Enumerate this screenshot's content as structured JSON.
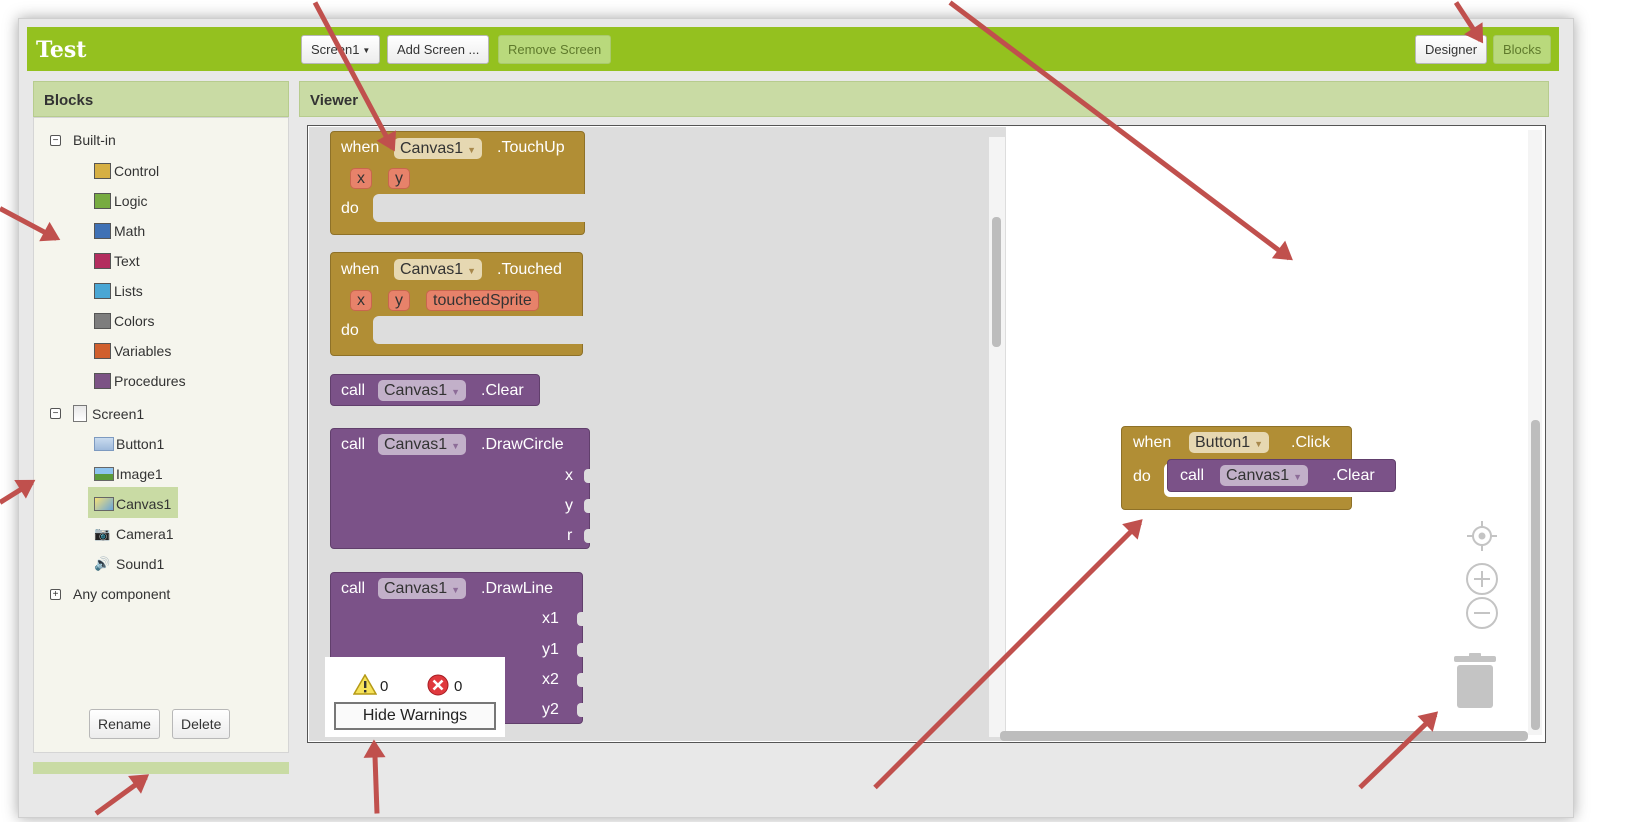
{
  "app": {
    "title": "Test"
  },
  "toolbar": {
    "screen_select": "Screen1",
    "add_screen": "Add Screen ...",
    "remove_screen": "Remove Screen",
    "designer": "Designer",
    "blocks": "Blocks"
  },
  "blocks_panel": {
    "title": "Blocks",
    "builtin_label": "Built-in",
    "builtin_items": [
      {
        "label": "Control",
        "color": "#d6af43"
      },
      {
        "label": "Logic",
        "color": "#77ab41"
      },
      {
        "label": "Math",
        "color": "#3f71b5"
      },
      {
        "label": "Text",
        "color": "#b32d5e"
      },
      {
        "label": "Lists",
        "color": "#49a6d4"
      },
      {
        "label": "Colors",
        "color": "#7d7d7d"
      },
      {
        "label": "Variables",
        "color": "#d05f2d"
      },
      {
        "label": "Procedures",
        "color": "#7c5385"
      }
    ],
    "screen_label": "Screen1",
    "components": [
      "Button1",
      "Image1",
      "Canvas1",
      "Camera1",
      "Sound1"
    ],
    "any_component": "Any component",
    "rename": "Rename",
    "delete": "Delete"
  },
  "viewer": {
    "title": "Viewer"
  },
  "flyout": {
    "touchup": {
      "when": "when",
      "component": "Canvas1",
      "event": ".TouchUp",
      "params": [
        "x",
        "y"
      ],
      "do": "do"
    },
    "touched": {
      "when": "when",
      "component": "Canvas1",
      "event": ".Touched",
      "params": [
        "x",
        "y",
        "touchedSprite"
      ],
      "do": "do"
    },
    "clear": {
      "call": "call",
      "component": "Canvas1",
      "method": ".Clear"
    },
    "drawcircle": {
      "call": "call",
      "component": "Canvas1",
      "method": ".DrawCircle",
      "args": [
        "x",
        "y",
        "r"
      ]
    },
    "drawline": {
      "call": "call",
      "component": "Canvas1",
      "method": ".DrawLine",
      "args": [
        "x1",
        "y1",
        "x2",
        "y2"
      ]
    }
  },
  "workspace_block": {
    "when": "when",
    "component": "Button1",
    "event": ".Click",
    "do": "do",
    "call": "call",
    "call_component": "Canvas1",
    "call_method": ".Clear"
  },
  "warnings": {
    "warning_count": "0",
    "error_count": "0",
    "hide_button": "Hide Warnings"
  },
  "colors": {
    "accent": "#94c11f",
    "event_block": "#b18e35",
    "method_block": "#7b5288",
    "annotation_arrow": "#c0504d"
  }
}
